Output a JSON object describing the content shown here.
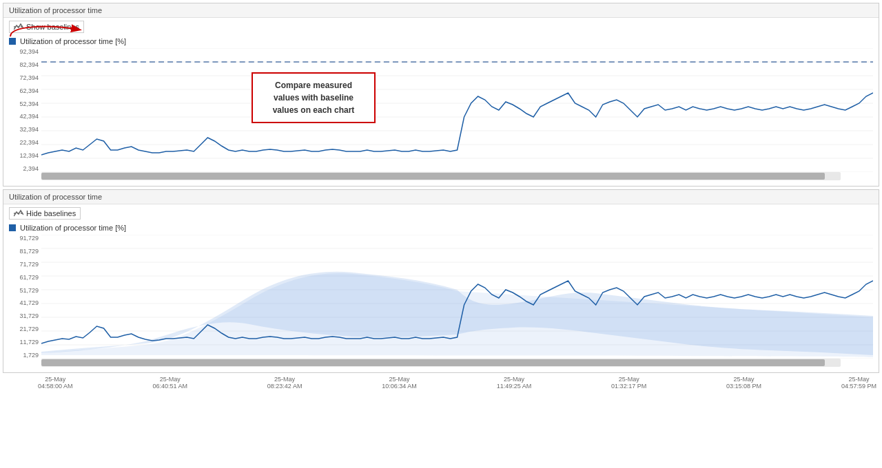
{
  "panel1": {
    "title": "Utilization of processor time",
    "showBaselines": "Show baselines",
    "legendLabel": "Utilization of processor time [%]",
    "yAxisValues": [
      "92,394",
      "82,394",
      "72,394",
      "62,394",
      "52,394",
      "42,394",
      "32,394",
      "22,394",
      "12,394",
      "2,394"
    ],
    "baselineValue": 82.394
  },
  "panel2": {
    "title": "Utilization of processor time",
    "hideBaselines": "Hide baselines",
    "legendLabel": "Utilization of processor time [%]",
    "yAxisValues": [
      "91,729",
      "81,729",
      "71,729",
      "61,729",
      "51,729",
      "41,729",
      "31,729",
      "21,729",
      "11,729",
      "1,729"
    ]
  },
  "xAxis": {
    "labels": [
      {
        "line1": "25-May",
        "line2": "04:58:00 AM"
      },
      {
        "line1": "25-May",
        "line2": "06:40:51 AM"
      },
      {
        "line1": "25-May",
        "line2": "08:23:42 AM"
      },
      {
        "line1": "25-May",
        "line2": "10:06:34 AM"
      },
      {
        "line1": "25-May",
        "line2": "11:49:25 AM"
      },
      {
        "line1": "25-May",
        "line2": "01:32:17 PM"
      },
      {
        "line1": "25-May",
        "line2": "03:15:08 PM"
      },
      {
        "line1": "25-May",
        "line2": "04:57:59 PM"
      }
    ]
  },
  "tooltip": {
    "text": "Compare measured values with baseline values on each chart"
  }
}
